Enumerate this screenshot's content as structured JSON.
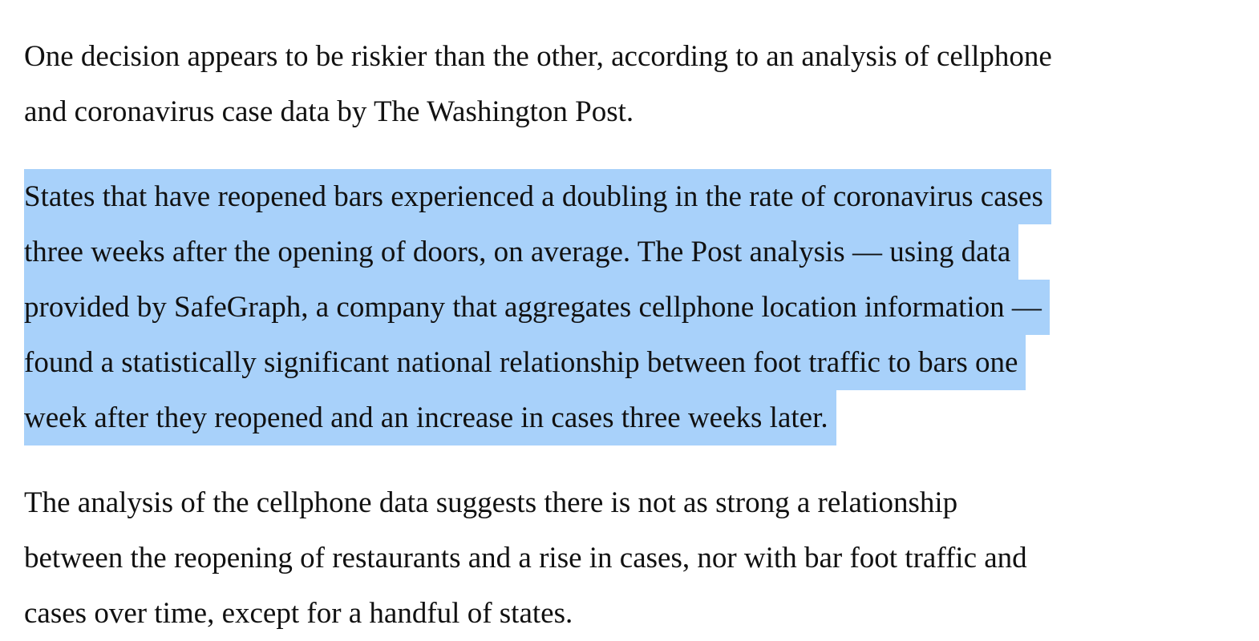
{
  "article": {
    "paragraphs": [
      {
        "highlighted": false,
        "lines": [
          "One decision appears to be riskier than the other, according to an analysis of cellphone",
          "and coronavirus case data by The Washington Post."
        ]
      },
      {
        "highlighted": true,
        "highlight_color": "#a8d1fa",
        "lines": [
          "States that have reopened bars experienced a doubling in the rate of coronavirus cases",
          "three weeks after the opening of doors, on average. The Post analysis — using data",
          "provided by SafeGraph, a company that aggregates cellphone location information —",
          "found a statistically significant national relationship between foot traffic to bars one",
          "week after they reopened and an increase in cases three weeks later."
        ]
      },
      {
        "highlighted": false,
        "lines": [
          "The analysis of the cellphone data suggests there is not as strong a relationship",
          "between the reopening of restaurants and a rise in cases, nor with bar foot traffic and",
          "cases over time, except for a handful of states."
        ]
      }
    ]
  }
}
